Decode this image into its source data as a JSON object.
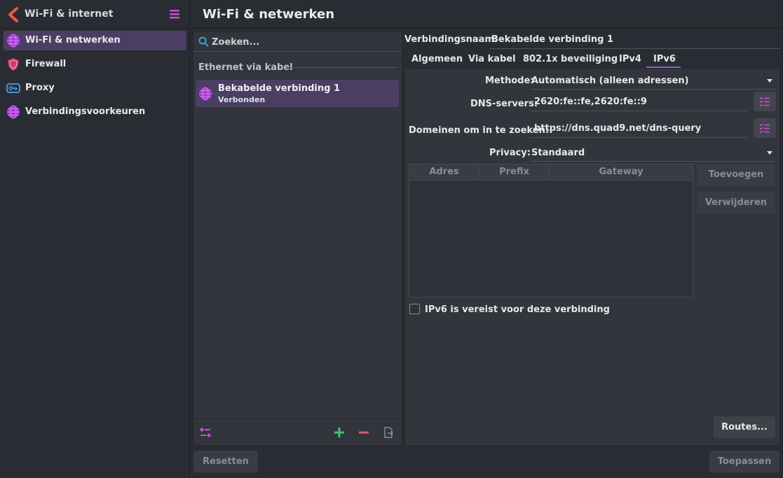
{
  "sidebar": {
    "title": "Wi-Fi & internet",
    "items": [
      {
        "label": "Wi-Fi & netwerken",
        "icon": "globe-icon",
        "active": true
      },
      {
        "label": "Firewall",
        "icon": "shield-icon",
        "active": false
      },
      {
        "label": "Proxy",
        "icon": "key-icon",
        "active": false
      },
      {
        "label": "Verbindingsvoorkeuren",
        "icon": "globe-icon",
        "active": false
      }
    ]
  },
  "header": {
    "title": "Wi-Fi & netwerken"
  },
  "connections": {
    "search_placeholder": "Zoeken...",
    "group_title": "Ethernet via kabel",
    "items": [
      {
        "name": "Bekabelde verbinding 1",
        "status": "Verbonden"
      }
    ]
  },
  "editor": {
    "name_label": "Verbindingsnaam:",
    "name_value": "Bekabelde verbinding 1",
    "tabs": [
      "Algemeen",
      "Via kabel",
      "802.1x beveiliging",
      "IPv4",
      "IPv6"
    ],
    "active_tab": "IPv6",
    "method_label": "Methode:",
    "method_value": "Automatisch (alleen adressen)",
    "dns_label": "DNS-servers:",
    "dns_value": "2620:fe::fe,2620:fe::9",
    "domains_label": "Domeinen om in te zoeken:",
    "domains_value": "https://dns.quad9.net/dns-query",
    "privacy_label": "Privacy:",
    "privacy_value": "Standaard",
    "table_headers": [
      "Adres",
      "Prefix",
      "Gateway"
    ],
    "add_button": "Toevoegen",
    "remove_button": "Verwijderen",
    "required_checkbox": "IPv6 is vereist voor deze verbinding",
    "routes_button": "Routes..."
  },
  "footer": {
    "reset": "Resetten",
    "apply": "Toepassen"
  },
  "colors": {
    "accent": "#8a63d2",
    "selection": "#4a3f63",
    "add": "#3ec46d",
    "remove": "#e0556b",
    "icon_purple": "#b94fe0"
  }
}
